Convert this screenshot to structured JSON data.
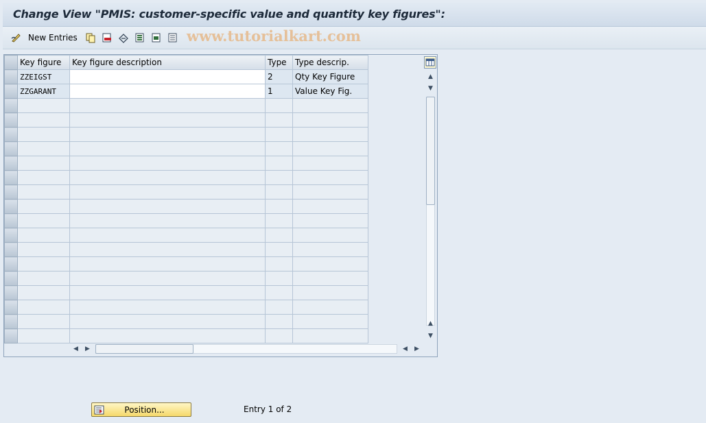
{
  "title": "Change View \"PMIS: customer-specific value and quantity key figures\":",
  "toolbar": {
    "edit_icon": "pencil-glasses-icon",
    "new_entries_label": "New Entries",
    "icons": [
      "copy-icon",
      "delete-icon",
      "undo-icon",
      "select-all-icon",
      "select-block-icon",
      "deselect-all-icon"
    ],
    "watermark": "www.tutorialkart.com"
  },
  "table": {
    "columns": [
      "Key figure",
      "Key figure description",
      "Type",
      "Type descrip."
    ],
    "rows": [
      {
        "key_figure": "ZZEIGST",
        "description": "",
        "type": "2",
        "type_descr": "Qty Key Figure"
      },
      {
        "key_figure": "ZZGARANT",
        "description": "",
        "type": "1",
        "type_descr": "Value Key Fig."
      }
    ],
    "empty_rows": 17
  },
  "footer": {
    "position_label": "Position...",
    "entry_info": "Entry 1 of 2"
  },
  "colors": {
    "background": "#e4ebf3",
    "title_text": "#1d2a3a",
    "button_yellow": "#f5d86a",
    "watermark": "#e6b98a"
  }
}
